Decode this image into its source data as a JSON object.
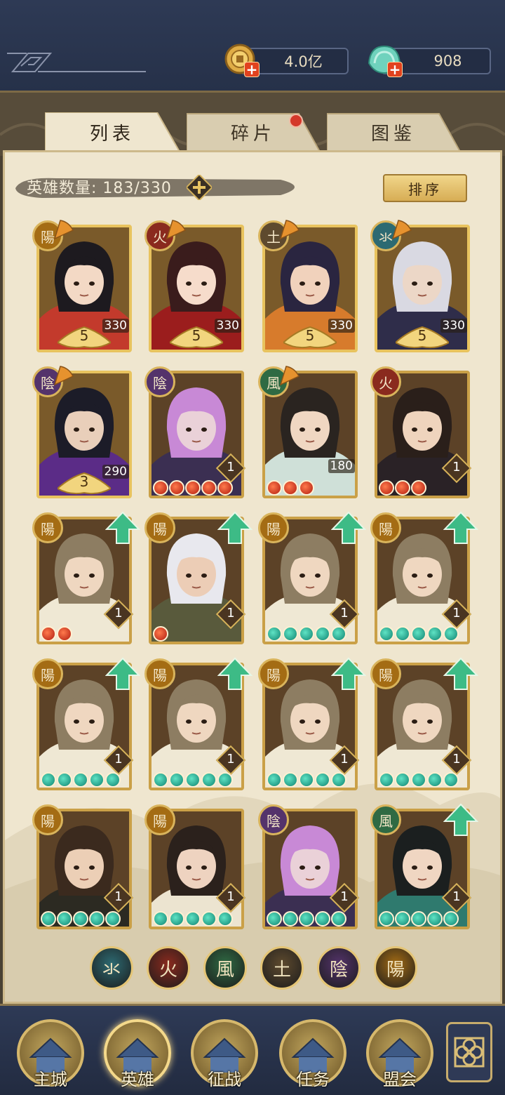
{
  "resources": {
    "gold": "4.0亿",
    "jade": "908"
  },
  "tabs": [
    {
      "label": "列表",
      "active": true
    },
    {
      "label": "碎片",
      "active": false,
      "has_badge": true
    },
    {
      "label": "图鉴",
      "active": false
    }
  ],
  "hero_count": {
    "label": "英雄数量:",
    "value": "183/330"
  },
  "sort_label": "排序",
  "element_glyphs": {
    "water": "氺",
    "fire": "火",
    "wind": "風",
    "earth": "土",
    "yin": "陰",
    "yang": "陽"
  },
  "element_colors": {
    "water": "#2d6a72",
    "fire": "#8a2a1e",
    "wind": "#2f6a43",
    "earth": "#5e4a2e",
    "yin": "#54336b",
    "yang": "#a46c14"
  },
  "heroes": [
    {
      "element": "陽",
      "el": "yang",
      "stars": "5",
      "frags": "330",
      "type": "star",
      "skin": "#f3d9c5",
      "hair": "#1d1a1f",
      "cloth": "#c33a2c"
    },
    {
      "element": "火",
      "el": "fire",
      "stars": "5",
      "frags": "330",
      "type": "star",
      "skin": "#f6dccb",
      "hair": "#3a1c1c",
      "cloth": "#9b1d1d"
    },
    {
      "element": "土",
      "el": "earth",
      "stars": "5",
      "frags": "330",
      "type": "star",
      "skin": "#f1d2bc",
      "hair": "#2a2540",
      "cloth": "#d77b2c"
    },
    {
      "element": "氺",
      "el": "water",
      "stars": "5",
      "frags": "330",
      "type": "star",
      "skin": "#ecd7c7",
      "hair": "#d9d9e2",
      "cloth": "#2f2d4a"
    },
    {
      "element": "陰",
      "el": "yin",
      "stars": "3",
      "frags": "290",
      "type": "star",
      "skin": "#e9cfba",
      "hair": "#1c1c28",
      "cloth": "#5b2c87"
    },
    {
      "element": "陰",
      "el": "yin",
      "level": "1",
      "orbs": 5,
      "orb_color": "red",
      "skin": "#ead1d8",
      "hair": "#c889d6",
      "cloth": "#3b2f52"
    },
    {
      "element": "風",
      "el": "wind",
      "frags": "180",
      "orbs": 3,
      "orb_color": "red",
      "skin": "#f0d7c2",
      "hair": "#2a2420",
      "cloth": "#cfe0d8"
    },
    {
      "element": "火",
      "el": "fire",
      "level": "1",
      "orbs": 3,
      "orb_color": "red",
      "skin": "#efd4bd",
      "hair": "#2a1f1a",
      "cloth": "#2a2226"
    },
    {
      "element": "陽",
      "el": "yang",
      "level": "1",
      "orbs": 2,
      "orb_color": "red",
      "upgrade": true,
      "skin": "#efd7c0",
      "hair": "#8d7d62",
      "cloth": "#efe8d4"
    },
    {
      "element": "陽",
      "el": "yang",
      "level": "1",
      "orbs": 1,
      "orb_color": "red",
      "upgrade": true,
      "skin": "#eccdb6",
      "hair": "#e8e8ee",
      "cloth": "#595a3c"
    },
    {
      "element": "陽",
      "el": "yang",
      "level": "1",
      "orbs": 5,
      "orb_color": "teal",
      "upgrade": true,
      "skin": "#efd7c0",
      "hair": "#8d7d62",
      "cloth": "#efe8d4"
    },
    {
      "element": "陽",
      "el": "yang",
      "level": "1",
      "orbs": 5,
      "orb_color": "teal",
      "upgrade": true,
      "skin": "#efd7c0",
      "hair": "#8d7d62",
      "cloth": "#efe8d4"
    },
    {
      "element": "陽",
      "el": "yang",
      "level": "1",
      "orbs": 5,
      "orb_color": "teal",
      "upgrade": true,
      "skin": "#efd7c0",
      "hair": "#8d7d62",
      "cloth": "#efe8d4"
    },
    {
      "element": "陽",
      "el": "yang",
      "level": "1",
      "orbs": 5,
      "orb_color": "teal",
      "upgrade": true,
      "skin": "#efd7c0",
      "hair": "#8d7d62",
      "cloth": "#efe8d4"
    },
    {
      "element": "陽",
      "el": "yang",
      "level": "1",
      "orbs": 5,
      "orb_color": "teal",
      "upgrade": true,
      "skin": "#efd7c0",
      "hair": "#8d7d62",
      "cloth": "#efe8d4"
    },
    {
      "element": "陽",
      "el": "yang",
      "level": "1",
      "orbs": 5,
      "orb_color": "teal",
      "upgrade": true,
      "skin": "#efd7c0",
      "hair": "#8d7d62",
      "cloth": "#efe8d4"
    },
    {
      "element": "陽",
      "el": "yang",
      "level": "1",
      "orbs": 5,
      "orb_color": "teal",
      "skin": "#eccfb6",
      "hair": "#3b2a1e",
      "cloth": "#2c2a22"
    },
    {
      "element": "陽",
      "el": "yang",
      "level": "1",
      "orbs": 5,
      "orb_color": "teal",
      "skin": "#eed3c0",
      "hair": "#2b211c",
      "cloth": "#ece4d0"
    },
    {
      "element": "陰",
      "el": "yin",
      "level": "1",
      "orbs": 5,
      "orb_color": "teal",
      "skin": "#ead1d8",
      "hair": "#c889d6",
      "cloth": "#3b2f52"
    },
    {
      "element": "風",
      "el": "wind",
      "level": "1",
      "orbs": 5,
      "orb_color": "teal",
      "upgrade": true,
      "skin": "#f0d6c2",
      "hair": "#1b1f1f",
      "cloth": "#2f7a6e"
    }
  ],
  "element_filters": [
    {
      "glyph": "氺",
      "el": "water"
    },
    {
      "glyph": "火",
      "el": "fire"
    },
    {
      "glyph": "風",
      "el": "wind"
    },
    {
      "glyph": "土",
      "el": "earth"
    },
    {
      "glyph": "陰",
      "el": "yin"
    },
    {
      "glyph": "陽",
      "el": "yang"
    }
  ],
  "nav": [
    {
      "label": "主城",
      "icon": "palace-icon",
      "active": false
    },
    {
      "label": "英雄",
      "icon": "hero-icon",
      "active": true
    },
    {
      "label": "征战",
      "icon": "battle-icon",
      "active": false
    },
    {
      "label": "任务",
      "icon": "quest-icon",
      "active": false
    },
    {
      "label": "盟会",
      "icon": "guild-icon",
      "active": false
    }
  ]
}
